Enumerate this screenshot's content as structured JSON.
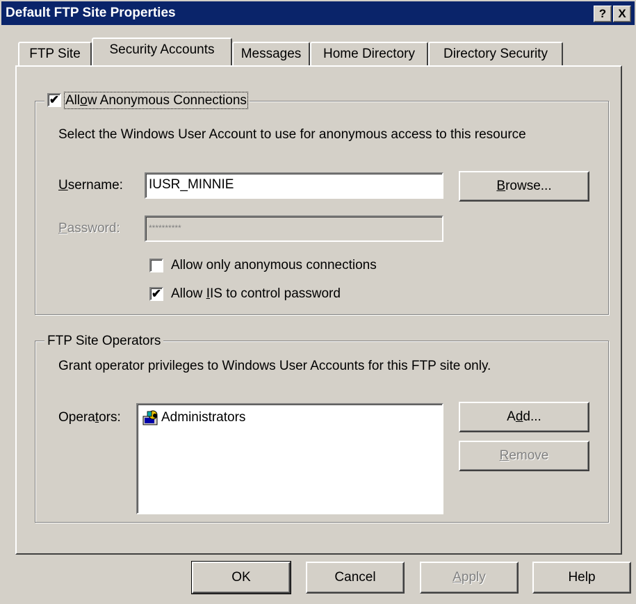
{
  "window": {
    "title": "Default FTP Site Properties",
    "help_btn": "?",
    "close_btn": "X"
  },
  "tabs": [
    {
      "label": "FTP Site"
    },
    {
      "label": "Security Accounts"
    },
    {
      "label": "Messages"
    },
    {
      "label": "Home Directory"
    },
    {
      "label": "Directory Security"
    }
  ],
  "anonymous": {
    "checkbox_pre": "All",
    "checkbox_ul": "o",
    "checkbox_post": "w Anonymous Connections",
    "checked_mark": "✔",
    "description": "Select the Windows User Account to use for anonymous access to this resource",
    "username_label_ul": "U",
    "username_label_rest": "sername:",
    "username_value": "IUSR_MINNIE",
    "password_label_ul": "P",
    "password_label_rest": "assword:",
    "password_value": "**********",
    "browse_ul": "B",
    "browse_rest": "rowse...",
    "only_anon_label": "Allow only anonymous connections",
    "iis_pre": "Allow ",
    "iis_ul": "I",
    "iis_post": "IS to control password"
  },
  "operators": {
    "group_title": "FTP Site Operators",
    "description": "Grant operator privileges to Windows User Accounts for this FTP site only.",
    "label_pre": "Opera",
    "label_ul": "t",
    "label_post": "ors:",
    "items": [
      "Administrators"
    ],
    "add_pre": "A",
    "add_ul": "d",
    "add_post": "d...",
    "remove_ul": "R",
    "remove_rest": "emove"
  },
  "footer": {
    "ok": "OK",
    "cancel": "Cancel",
    "apply_ul": "A",
    "apply_rest": "pply",
    "help": "Help"
  }
}
